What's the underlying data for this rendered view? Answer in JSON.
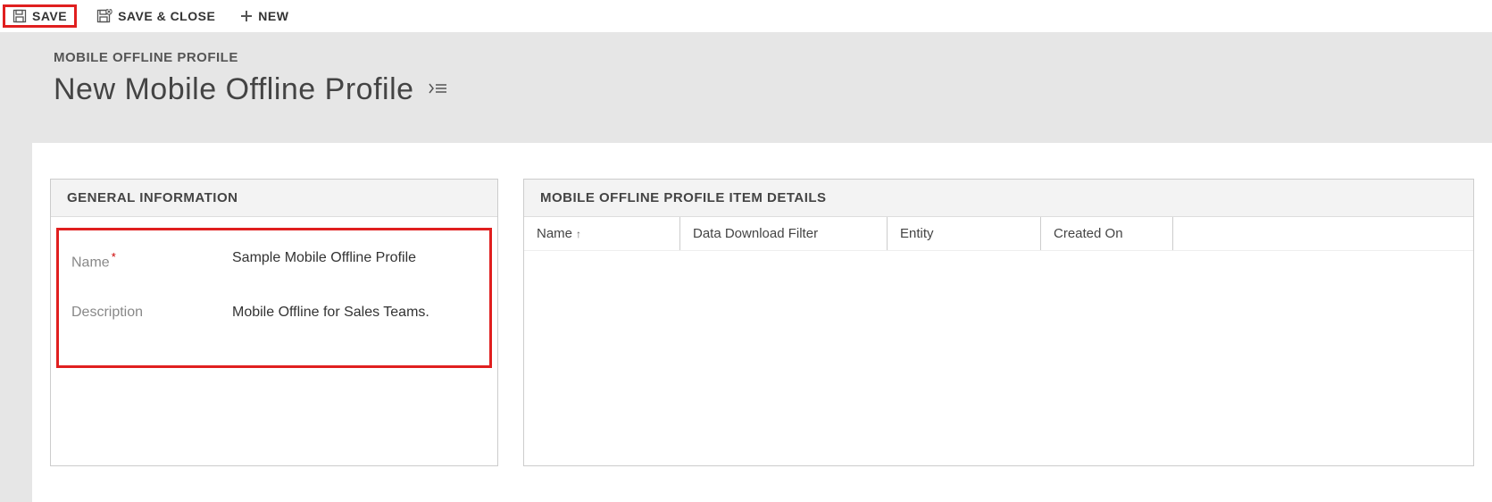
{
  "toolbar": {
    "save_label": "SAVE",
    "save_close_label": "SAVE & CLOSE",
    "new_label": "NEW"
  },
  "header": {
    "breadcrumb": "MOBILE OFFLINE PROFILE",
    "title": "New Mobile Offline Profile"
  },
  "general": {
    "panel_title": "GENERAL INFORMATION",
    "name_label": "Name",
    "name_value": "Sample Mobile Offline Profile",
    "description_label": "Description",
    "description_value": "Mobile Offline for Sales Teams."
  },
  "details": {
    "panel_title": "MOBILE OFFLINE PROFILE ITEM DETAILS",
    "columns": {
      "name": "Name",
      "filter": "Data Download Filter",
      "entity": "Entity",
      "created": "Created On"
    },
    "sort_indicator": "↑"
  }
}
